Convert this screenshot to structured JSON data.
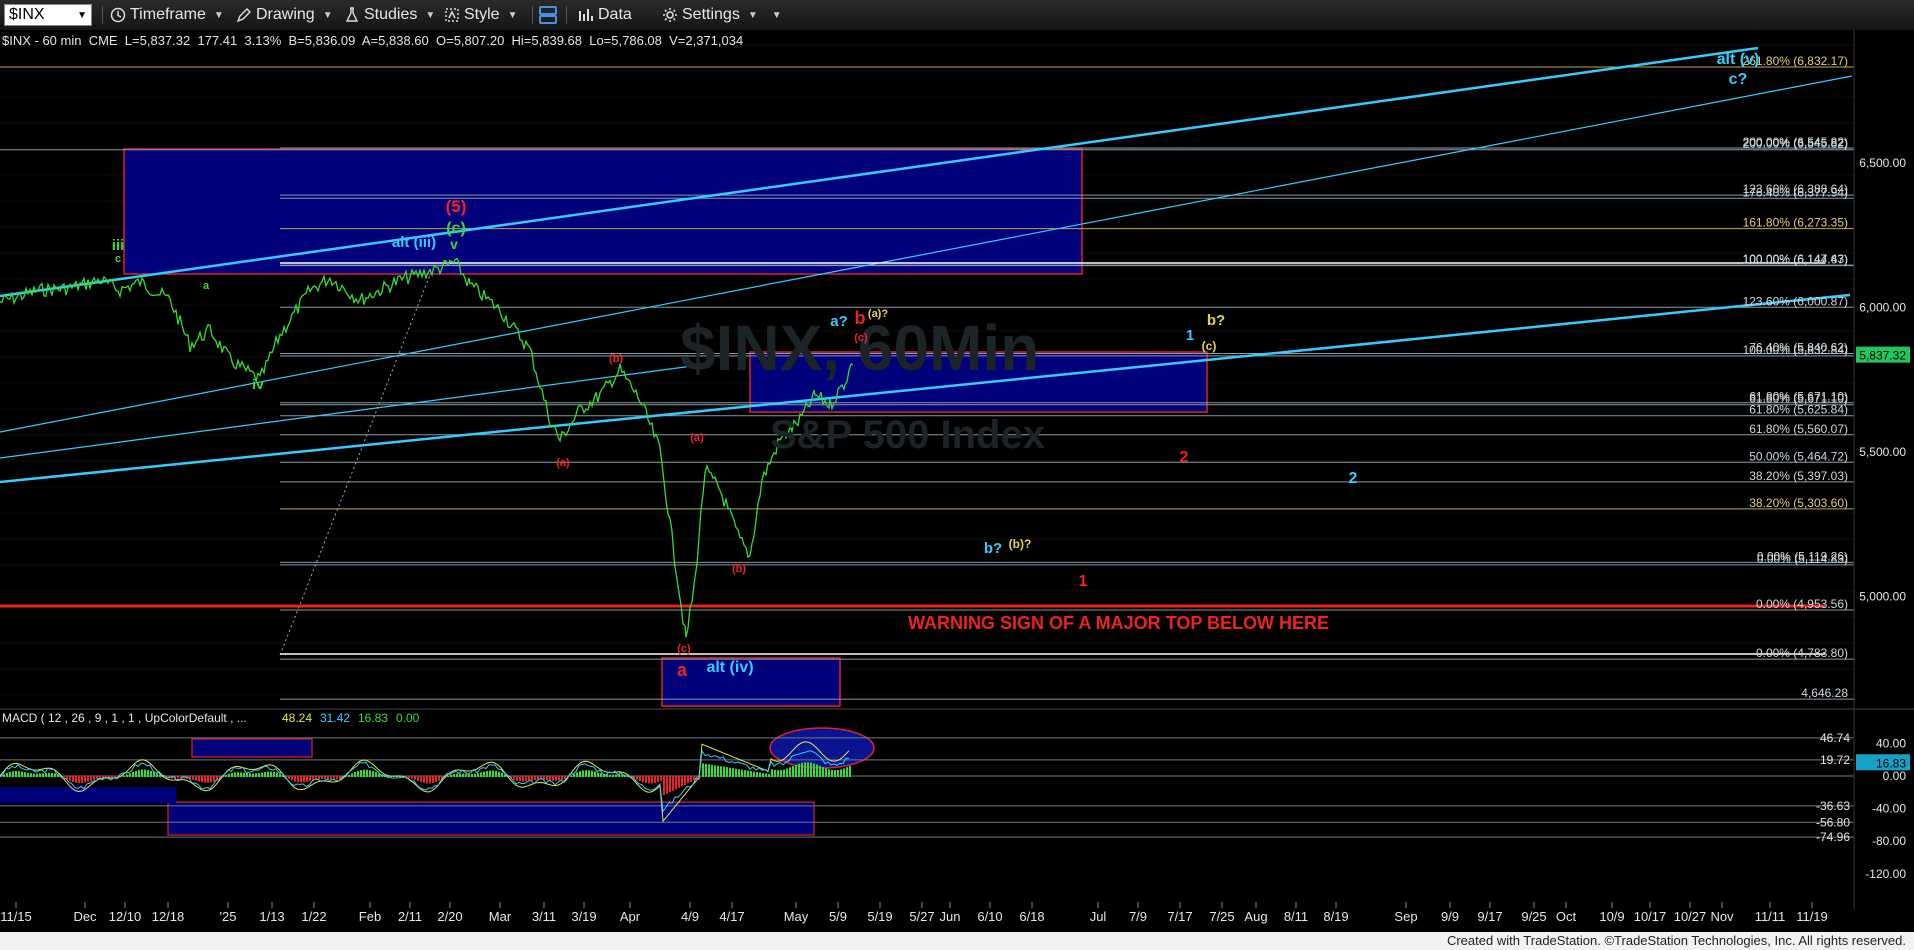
{
  "toolbar": {
    "symbol": "$INX",
    "timeframe": "Timeframe",
    "drawing": "Drawing",
    "studies": "Studies",
    "style": "Style",
    "data": "Data",
    "settings": "Settings"
  },
  "price_header": "$INX - 60 min  CME  L=5,837.32  177.41  3.13%  B=5,836.09  A=5,838.60  O=5,807.20  Hi=5,839.68  Lo=5,786.08  V=2,371,034",
  "macd_header": {
    "label": "MACD ( 12 , 26 , 9 , 1 , 1 , UpColorDefault , ...",
    "v1": "48.24",
    "v2": "31.42",
    "v3": "16.83",
    "v4": "0.00"
  },
  "watermark": {
    "symbol": "$INX, 60Min",
    "name": "S&P 500 Index"
  },
  "warning_text": "WARNING SIGN OF A MAJOR TOP BELOW HERE",
  "footer": "Created with TradeStation. ©TradeStation Technologies, Inc. All rights reserved.",
  "colors": {
    "cyan": "#33ccff",
    "green": "#33dd33",
    "red": "#ee2222",
    "yellow": "#e6d24a",
    "blue_box": "#00007a",
    "last_price": "#22c55e"
  },
  "chart_data": {
    "type": "line",
    "price_axis": {
      "ticks": [
        "6,500.00",
        "6,000.00",
        "5,500.00",
        "5,000.00"
      ],
      "last_price": "5,837.32"
    },
    "macd_axis": {
      "ticks": [
        "40.00",
        "0.00",
        "-40.00",
        "-80.00",
        "-120.00"
      ],
      "level_labels": [
        "46.74",
        "19.72",
        "-36.63",
        "-56.80",
        "-74.96"
      ],
      "last_value": "16.83"
    },
    "x_tick_labels": [
      "11/15",
      "Dec",
      "12/10",
      "12/18",
      "'25",
      "1/13",
      "1/22",
      "Feb",
      "2/11",
      "2/20",
      "Mar",
      "3/11",
      "3/19",
      "Apr",
      "4/9",
      "4/17",
      "May",
      "5/9",
      "5/19",
      "5/27",
      "Jun",
      "6/10",
      "6/18",
      "Jul",
      "7/9",
      "7/17",
      "7/25",
      "Aug",
      "8/11",
      "8/19",
      "Sep",
      "9/9",
      "9/17",
      "9/25",
      "Oct",
      "10/9",
      "10/17",
      "10/27",
      "Nov",
      "11/11",
      "11/19"
    ],
    "fib_labels": [
      {
        "text": "261.80% (6,832.17)",
        "price": 6832
      },
      {
        "text": "200.00% (6,545.82)",
        "price": 6546
      },
      {
        "text": "200.00% (6,545.82)",
        "price": 6552
      },
      {
        "text": "123.60% (6,388.64)",
        "price": 6389
      },
      {
        "text": "176.40% (6,377.94)",
        "price": 6378
      },
      {
        "text": "161.80% (6,273.35)",
        "price": 6273
      },
      {
        "text": "100.00% (6,147.43)",
        "price": 6147
      },
      {
        "text": "100.00% (6,144.67)",
        "price": 6145
      },
      {
        "text": "123.60% (6,000.87)",
        "price": 6001
      },
      {
        "text": "76.40% (5,840.62)",
        "price": 5841
      },
      {
        "text": "100.00% (5,832.84)",
        "price": 5833
      },
      {
        "text": "61.80% (5,671.10)",
        "price": 5671
      },
      {
        "text": "61.80% (5,671.10)",
        "price": 5664
      },
      {
        "text": "61.80% (5,625.84)",
        "price": 5626
      },
      {
        "text": "61.80% (5,560.07)",
        "price": 5560
      },
      {
        "text": "50.00% (5,464.72)",
        "price": 5465
      },
      {
        "text": "38.20% (5,397.03)",
        "price": 5397
      },
      {
        "text": "38.20% (5,303.60)",
        "price": 5304
      },
      {
        "text": "0.00% (5,119.26)",
        "price": 5119
      },
      {
        "text": "0.00% (5,114.83)",
        "price": 5110
      },
      {
        "text": "0.00% (4,953.56)",
        "price": 4954
      },
      {
        "text": "0.00% (4,783.80)",
        "price": 4784
      },
      {
        "text": "4,646.28",
        "price": 4646
      }
    ],
    "wave_labels": [
      {
        "text": "iii",
        "color": "green"
      },
      {
        "text": "c",
        "color": "green"
      },
      {
        "text": "iv",
        "color": "green"
      },
      {
        "text": "a",
        "color": "green"
      },
      {
        "text": "(5)",
        "color": "red"
      },
      {
        "text": "(c)",
        "color": "green"
      },
      {
        "text": "v",
        "color": "green"
      },
      {
        "text": "alt (iii)",
        "color": "cyan"
      },
      {
        "text": "(b)",
        "color": "red"
      },
      {
        "text": "(a)",
        "color": "red"
      },
      {
        "text": "(a)",
        "color": "red"
      },
      {
        "text": "(b)",
        "color": "red"
      },
      {
        "text": "(c)",
        "color": "red"
      },
      {
        "text": "a",
        "color": "red"
      },
      {
        "text": "alt (iv)",
        "color": "cyan"
      },
      {
        "text": "a?",
        "color": "cyan"
      },
      {
        "text": "b",
        "color": "red"
      },
      {
        "text": "(a)?",
        "color": "yellow"
      },
      {
        "text": "(c)",
        "color": "red"
      },
      {
        "text": "1",
        "color": "cyan"
      },
      {
        "text": "b?",
        "color": "yellow"
      },
      {
        "text": "(c)",
        "color": "yellow"
      },
      {
        "text": "2",
        "color": "red"
      },
      {
        "text": "2",
        "color": "cyan"
      },
      {
        "text": "b?",
        "color": "cyan"
      },
      {
        "text": "(b)?",
        "color": "yellow"
      },
      {
        "text": "1",
        "color": "red"
      },
      {
        "text": "alt (v)",
        "color": "cyan"
      },
      {
        "text": "c?",
        "color": "cyan"
      }
    ]
  }
}
